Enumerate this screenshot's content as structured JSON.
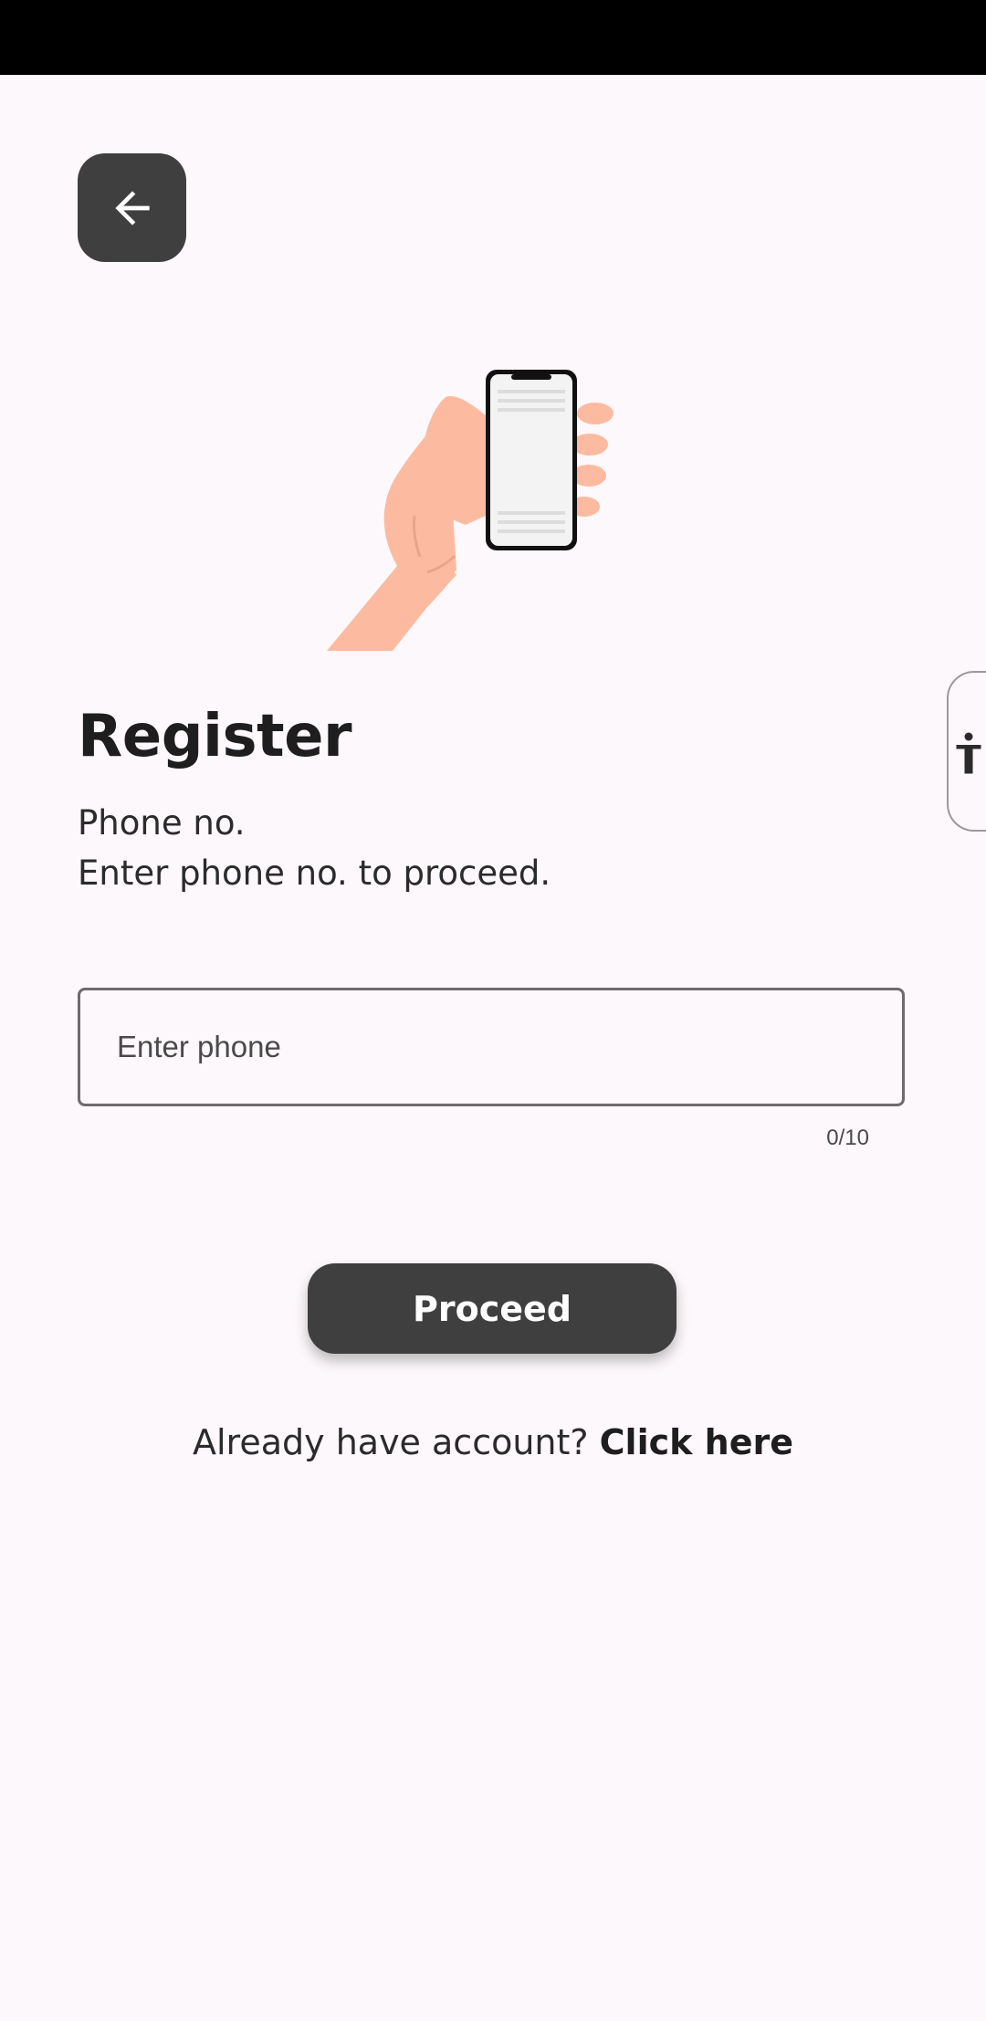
{
  "app": {
    "screen_title": "Register",
    "colors": {
      "background": "#fdf8fb",
      "primary_button": "#3f3f3f",
      "text": "#1e1e1e"
    }
  },
  "header": {
    "back_icon": "arrow-left-icon"
  },
  "hero": {
    "illustration": "hand-holding-phone-illustration"
  },
  "main": {
    "title": "Register",
    "subtitle_line1": "Phone no.",
    "subtitle_line2": "Enter phone no. to proceed."
  },
  "phone_input": {
    "placeholder": "Enter phone",
    "value": "",
    "counter": "0/10"
  },
  "actions": {
    "proceed_label": "Proceed"
  },
  "footer": {
    "login_prompt": "Already have account?",
    "login_link": "Click here"
  },
  "accessibility": {
    "icon": "accessibility-icon"
  }
}
